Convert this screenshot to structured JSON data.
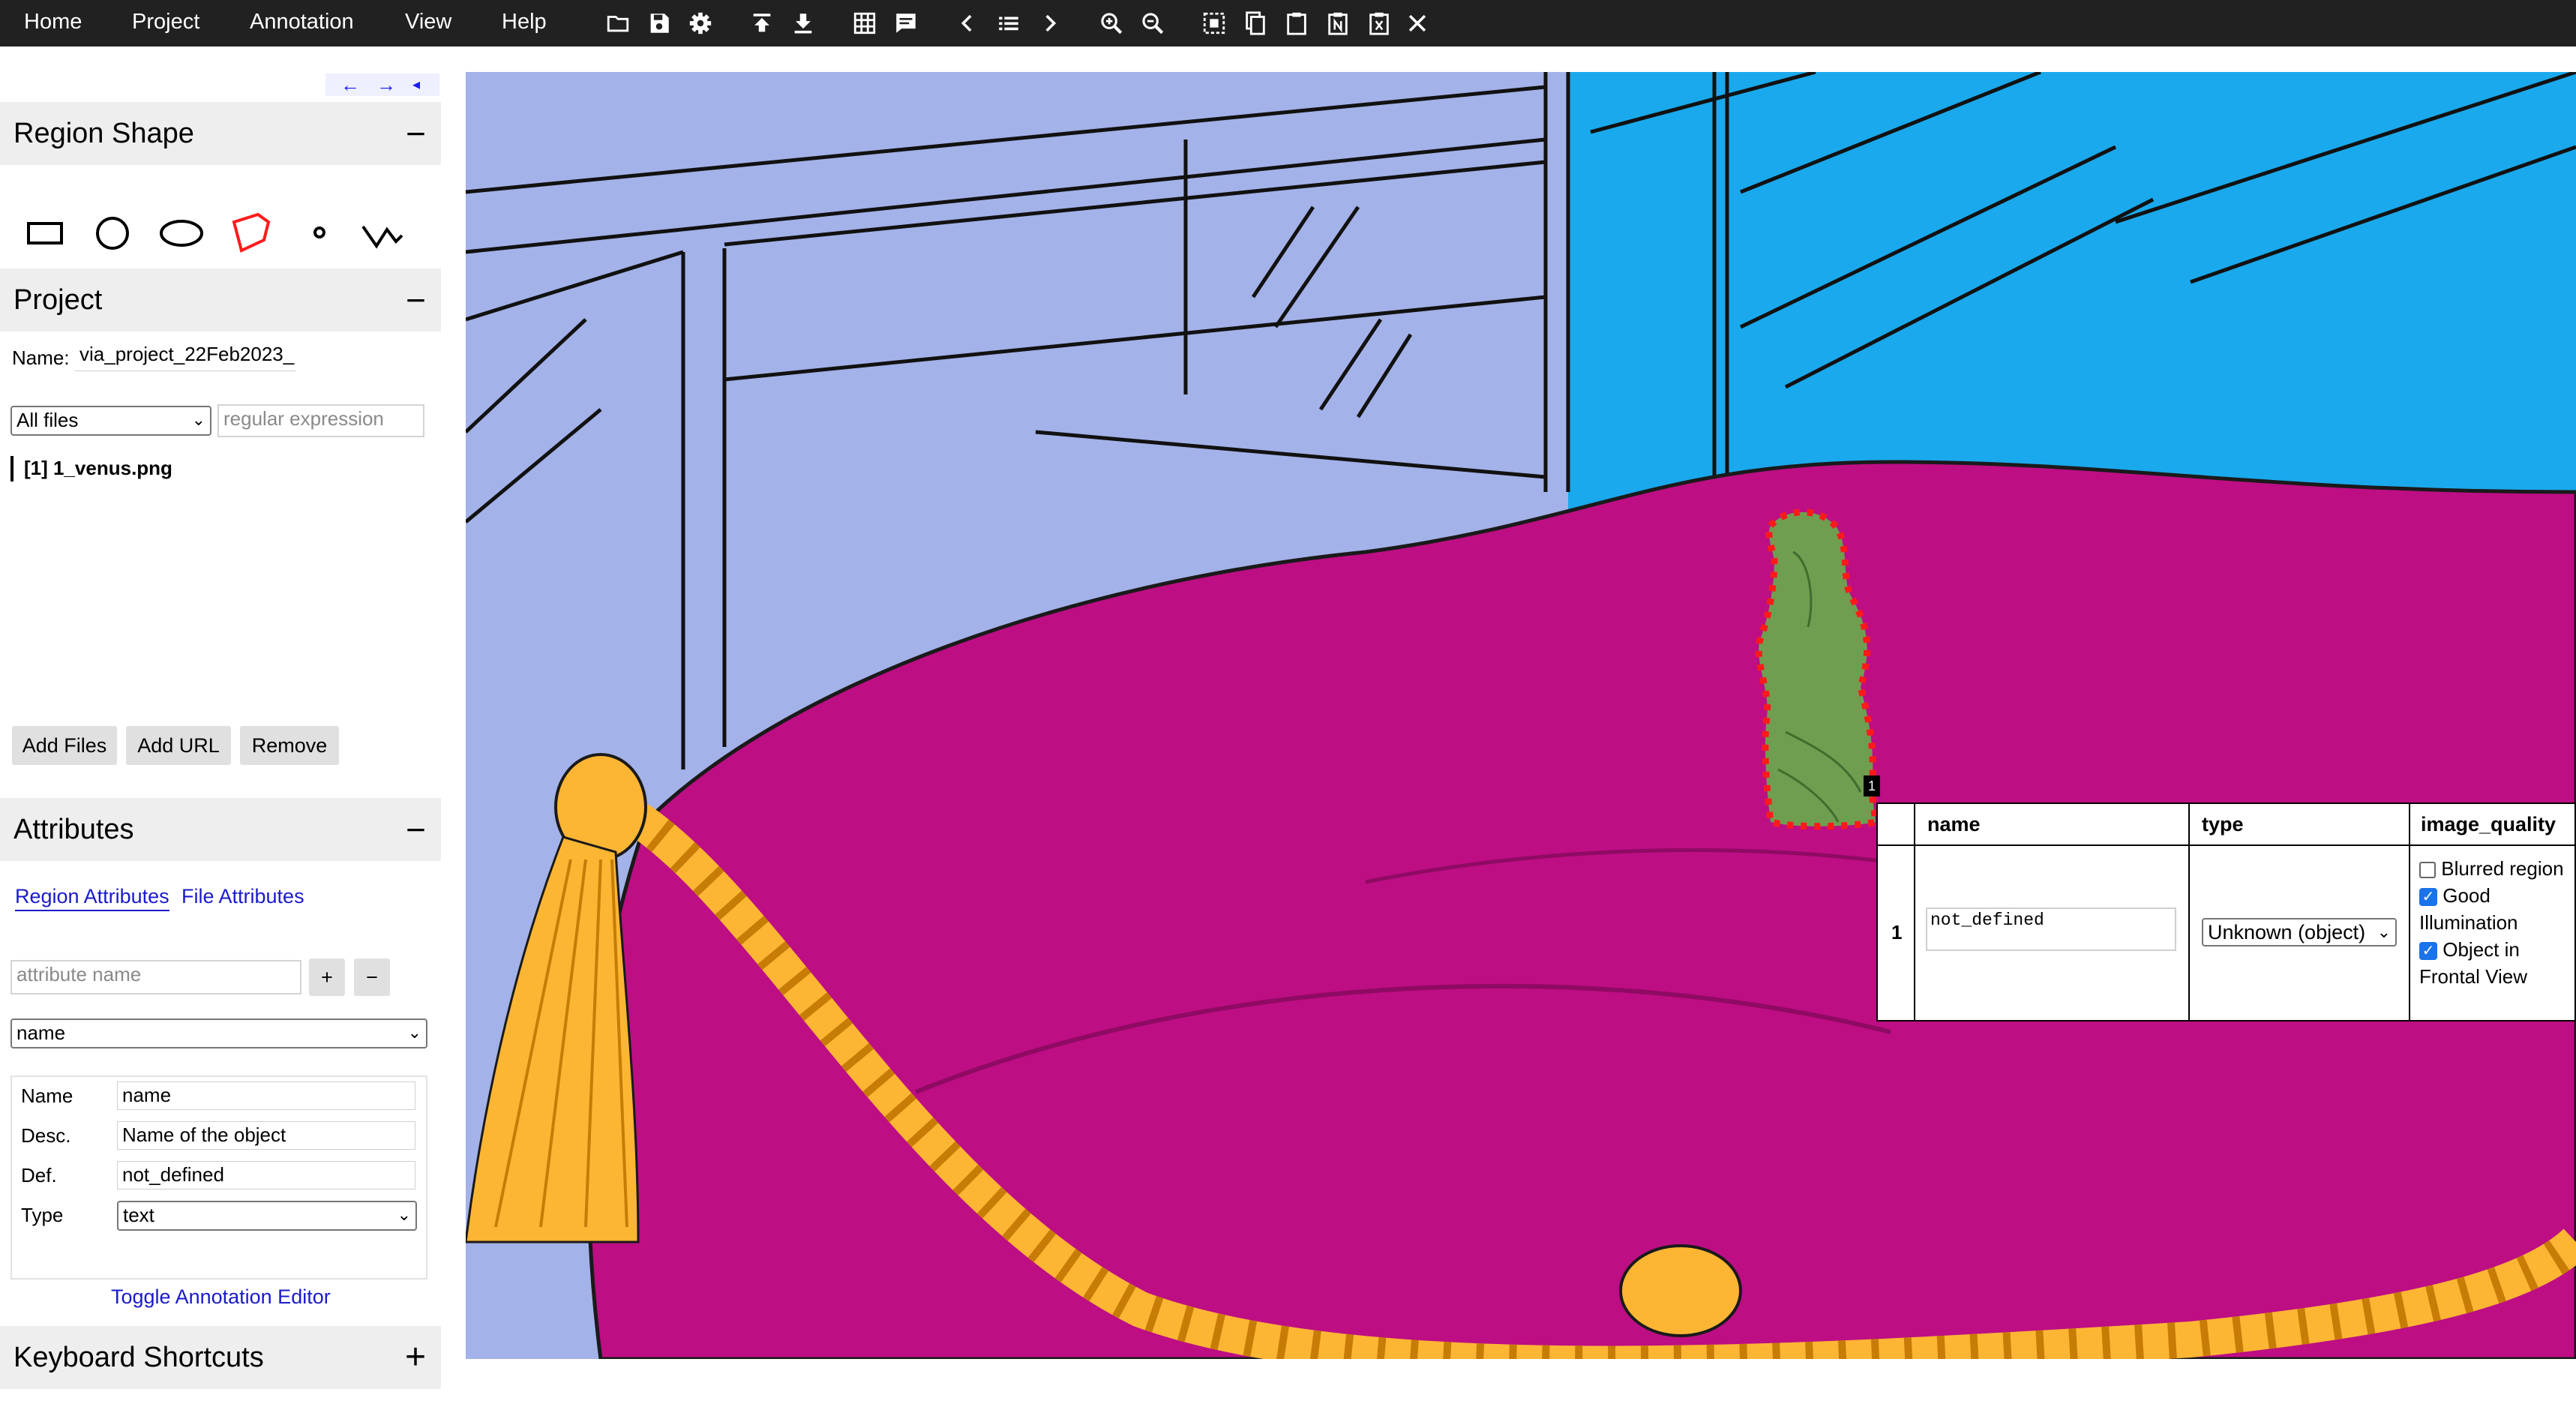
{
  "menu": {
    "home": "Home",
    "project": "Project",
    "annotation": "Annotation",
    "view": "View",
    "help": "Help"
  },
  "toolbar_icons": [
    "open-folder-icon",
    "save-icon",
    "settings-icon",
    "upload-icon",
    "download-icon",
    "grid-icon",
    "comment-icon",
    "previous-icon",
    "list-icon",
    "next-icon",
    "zoom-in-icon",
    "zoom-out-icon",
    "select-all-icon",
    "copy-icon",
    "paste-icon",
    "paste-n-icon",
    "delete-icon",
    "close-icon"
  ],
  "panel_nav": {
    "left": "←",
    "right": "→",
    "collapse": "◂"
  },
  "region_shape": {
    "title": "Region Shape",
    "toggle": "−",
    "shapes": [
      "rectangle-icon",
      "circle-icon",
      "ellipse-icon",
      "polygon-icon",
      "point-icon",
      "polyline-icon"
    ],
    "selected": "polygon-icon"
  },
  "project": {
    "title": "Project",
    "toggle": "−",
    "name_label": "Name:",
    "name_value": "via_project_22Feb2023_",
    "filter_select": "All files",
    "regex_placeholder": "regular expression",
    "files": [
      "[1] 1_venus.png"
    ],
    "buttons": {
      "add_files": "Add Files",
      "add_url": "Add URL",
      "remove": "Remove"
    }
  },
  "attributes": {
    "title": "Attributes",
    "toggle": "−",
    "tabs": {
      "region": "Region Attributes",
      "file": "File Attributes"
    },
    "attr_name_placeholder": "attribute name",
    "add": "+",
    "remove": "−",
    "selected_attribute": "name",
    "fields": {
      "name_label": "Name",
      "name_value": "name",
      "desc_label": "Desc.",
      "desc_value": "Name of the object",
      "def_label": "Def.",
      "def_value": "not_defined",
      "type_label": "Type",
      "type_value": "text"
    },
    "toggle_editor": "Toggle Annotation Editor"
  },
  "keyboard_shortcuts": {
    "title": "Keyboard Shortcuts",
    "toggle": "+"
  },
  "region_label": "1",
  "editor": {
    "headers": {
      "name": "name",
      "type": "type",
      "quality": "image_quality"
    },
    "row_index": "1",
    "name_value": "not_defined",
    "type_value": "Unknown (object)",
    "quality": {
      "blurred": "Blurred region",
      "good": "Good Illumination",
      "frontal": "Object in Frontal View"
    },
    "quality_checked": {
      "blurred": false,
      "good": true,
      "frontal": true
    }
  },
  "colors": {
    "topbar": "#212121",
    "panel_header": "#eeeeee",
    "sofa": "#bd0e84",
    "wall": "#a3b2e8",
    "sky": "#1aa9ec",
    "tassel": "#fdb634",
    "polygon_fill": "#6aa64d",
    "polygon_stroke": "#ff1a1a",
    "link": "#1a1acc"
  }
}
